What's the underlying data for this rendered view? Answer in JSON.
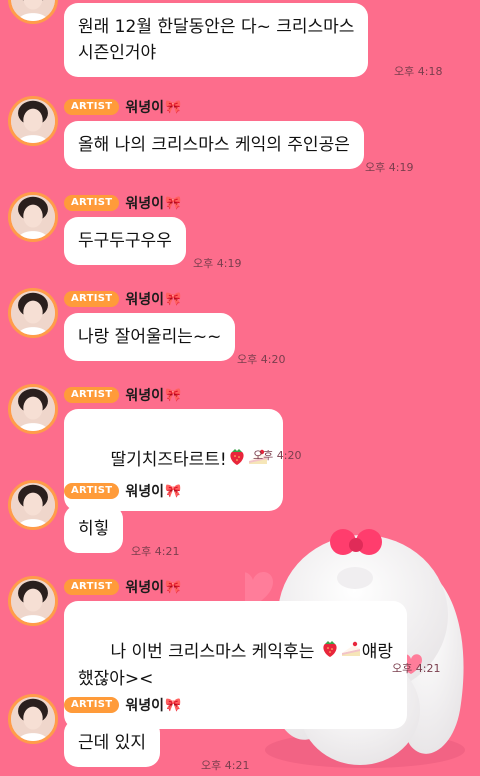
{
  "artist_name": "워녕이",
  "badge_label": "ARTIST",
  "ribbon": "🎀",
  "messages": [
    {
      "text": "원래 12월 한달동안은 다~ 크리스마스\n시즌인거야",
      "time": "오후 4:18"
    },
    {
      "text": "올해 나의 크리스마스 케익의 주인공은",
      "time": "오후 4:19"
    },
    {
      "text": "두구두구우우",
      "time": "오후 4:19"
    },
    {
      "text": "나랑 잘어울리는~~",
      "time": "오후 4:20"
    },
    {
      "text": "딸기치즈타르트!",
      "emoji": [
        "strawberry-icon",
        "cake-icon"
      ],
      "time": "오후 4:20"
    },
    {
      "text": "히힣",
      "time": "오후 4:21"
    },
    {
      "text_before": "나 이번 크리스마스 케익후는 ",
      "emoji": [
        "strawberry-icon",
        "cake-icon"
      ],
      "text_after": "얘랑\n했잖아><",
      "time": "오후 4:21"
    },
    {
      "text": "근데 있지",
      "time": "오후 4:21"
    }
  ],
  "colors": {
    "background": "#fd6d8c",
    "badge": "#ff9b3a",
    "bubble": "#ffffff",
    "time": "#7a3e4d"
  }
}
